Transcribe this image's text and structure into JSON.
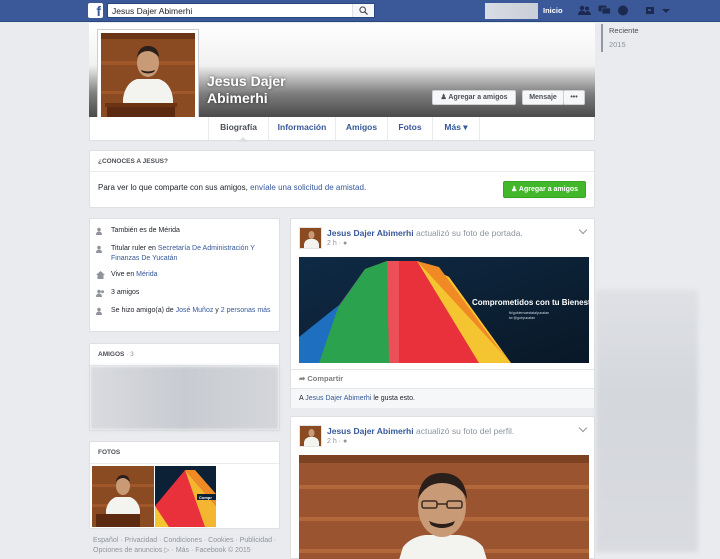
{
  "topbar": {
    "logo": "f",
    "search_value": "Jesus Dajer Abimerhi",
    "home": "Inicio"
  },
  "profile": {
    "name_line1": "Jesus Dajer",
    "name_line2": "Abimerhi",
    "add_friend": "Agregar a amigos",
    "message": "Mensaje",
    "more": "•••"
  },
  "tabs": [
    "Biografía",
    "Información",
    "Amigos",
    "Fotos",
    "Más ▾"
  ],
  "timeline_nav": [
    "Reciente",
    "2015"
  ],
  "know": {
    "heading": "¿CONOCES A JESUS?",
    "text": "Para ver lo que comparte con sus amigos, ",
    "link": "envíale una solicitud de amistad",
    "suffix": ".",
    "button": "Agregar a amigos"
  },
  "intro": {
    "row1": "También es de Mérida",
    "row2_pre": "Titular ruler en ",
    "row2_link": "Secretaría De Administración Y Finanzas De Yucatán",
    "row3_pre": "Vive en ",
    "row3_link": "Mérida",
    "row4": "3 amigos",
    "row5_pre": "Se hizo amigo(a) de ",
    "row5_link1": "José Muñoz",
    "row5_mid": " y ",
    "row5_link2": "2 personas más"
  },
  "friends": {
    "title": "AMIGOS",
    "count": "· 3"
  },
  "photos": {
    "title": "FOTOS"
  },
  "footer": "Español · Privacidad · Condiciones · Cookies · Publicidad · Opciones de anuncios ▷ · Más · Facebook © 2015",
  "post1": {
    "author": "Jesus Dajer Abimerhi",
    "action": " actualizó su foto de portada.",
    "time": "2 h · ",
    "banner_title": "Comprometidos con tu Bienestar",
    "banner_sub1": "fb/gobiernoestatalyucatan",
    "banner_sub2": "tw @gobyucatan",
    "share": "Compartir",
    "likes_pre": "A ",
    "likes_link": "Jesus Dajer Abimerhi",
    "likes_post": " le gusta esto."
  },
  "post2": {
    "author": "Jesus Dajer Abimerhi",
    "action": " actualizó su foto del perfil.",
    "time": "2 h · "
  },
  "colors": {
    "brand": "#3b5998",
    "link": "#365899",
    "green": "#42b72a"
  }
}
